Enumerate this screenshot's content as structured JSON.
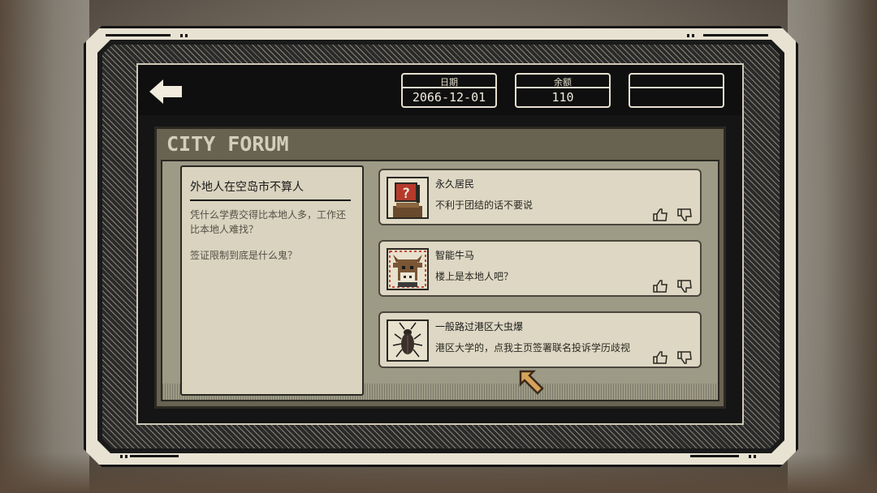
{
  "header": {
    "date_label": "日期",
    "date_value": "2066-12-01",
    "balance_label": "余额",
    "balance_value": "110",
    "third_label": "",
    "third_value": ""
  },
  "forum": {
    "title": "CITY FORUM",
    "topic": {
      "title": "外地人在空岛市不算人",
      "paragraphs": [
        "凭什么学费交得比本地人多，工作还比本地人难找？",
        "签证限制到底是什么鬼？"
      ]
    },
    "replies": [
      {
        "author": "永久居民",
        "text": "不利于团结的话不要说",
        "avatar_icon": "question-sign-avatar-icon"
      },
      {
        "author": "智能牛马",
        "text": "楼上是本地人吧？",
        "avatar_icon": "cow-avatar-icon"
      },
      {
        "author": "一般路过港区大虫爆",
        "text": "港区大学的，点我主页签署联名投诉学历歧视",
        "avatar_icon": "cockroach-avatar-icon"
      }
    ]
  },
  "colors": {
    "frame": "#e8e2d2",
    "screen": "#151515",
    "panel": "#686251",
    "card": "#ddd7c3",
    "text": "#1a1a1a",
    "cursor": "#d6a25a"
  }
}
